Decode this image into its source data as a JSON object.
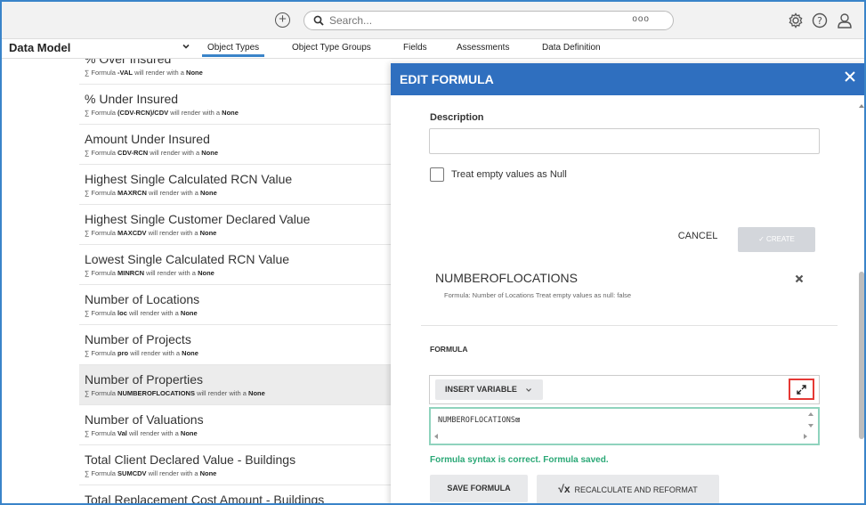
{
  "topbar": {
    "search_placeholder": "Search...",
    "more_label": "ooo"
  },
  "nav": {
    "title": "Data Model",
    "tabs": [
      {
        "label": "Object Types"
      },
      {
        "label": "Object Type Groups"
      },
      {
        "label": "Fields"
      },
      {
        "label": "Assessments"
      },
      {
        "label": "Data Definition"
      }
    ]
  },
  "list": {
    "formula_prefix": "∑ Formula",
    "render_text": "will render with a",
    "render_value": "None",
    "items": [
      {
        "title": "% Over Insured",
        "formula": "-VAL"
      },
      {
        "title": "% Under Insured",
        "formula": "(CDV-RCN)/CDV"
      },
      {
        "title": "Amount Under Insured",
        "formula": "CDV-RCN"
      },
      {
        "title": "Highest Single Calculated RCN Value",
        "formula": "MAXRCN"
      },
      {
        "title": "Highest Single Customer Declared Value",
        "formula": "MAXCDV"
      },
      {
        "title": "Lowest Single Calculated RCN Value",
        "formula": "MINRCN"
      },
      {
        "title": "Number of Locations",
        "formula": "loc"
      },
      {
        "title": "Number of Projects",
        "formula": "pro"
      },
      {
        "title": "Number of Properties",
        "formula": "NUMBEROFLOCATIONS"
      },
      {
        "title": "Number of Valuations",
        "formula": "Val"
      },
      {
        "title": "Total Client Declared Value - Buildings",
        "formula": "SUMCDV"
      },
      {
        "title": "Total Replacement Cost Amount - Buildings",
        "formula": ""
      }
    ]
  },
  "panel": {
    "title": "EDIT FORMULA",
    "description_label": "Description",
    "description_value": "",
    "treat_null_label": "Treat empty values as Null",
    "cancel_label": "CANCEL",
    "create_label": "✓ CREATE",
    "variable": {
      "name": "NUMBEROFLOCATIONS",
      "meta": "Formula: Number of Locations      Treat empty values as null: false"
    },
    "formula_label": "FORMULA",
    "insert_variable_label": "INSERT VARIABLE",
    "formula_text": "NUMBEROFLOCATIONS⊠",
    "syntax_message": "Formula syntax is correct. Formula saved.",
    "save_label": "SAVE FORMULA",
    "recalc_label": "RECALCULATE AND REFORMAT",
    "recalc_icon": "√x"
  },
  "colors": {
    "accent": "#2f6fbf",
    "success": "#2aa876",
    "highlight": "#e53935",
    "editor_border": "#8fd3bd"
  }
}
